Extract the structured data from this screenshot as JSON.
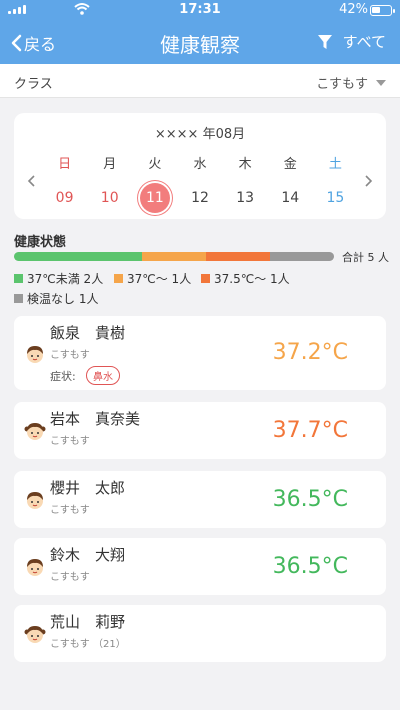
{
  "status_bar": {
    "time": "17:31",
    "battery": "42%"
  },
  "nav": {
    "back_label": "戻る",
    "title": "健康観察",
    "filter_label": "すべて"
  },
  "class_row": {
    "label": "クラス",
    "value": "こすもす"
  },
  "calendar": {
    "month": "×××× 年08月",
    "weekdays": [
      "日",
      "月",
      "火",
      "水",
      "木",
      "金",
      "土"
    ],
    "dates": [
      "09",
      "10",
      "11",
      "12",
      "13",
      "14",
      "15"
    ],
    "selected": "11"
  },
  "health": {
    "title": "健康状態",
    "total": "合計 5 人",
    "segments": [
      {
        "label": "37℃未満 2人",
        "count": 2,
        "color": "#5bc46d"
      },
      {
        "label": "37℃〜 1人",
        "count": 1,
        "color": "#f5a54a"
      },
      {
        "label": "37.5℃〜 1人",
        "count": 1,
        "color": "#f2763a"
      },
      {
        "label": "検温なし 1人",
        "count": 1,
        "color": "#999999"
      }
    ]
  },
  "students": [
    {
      "name": "飯泉　貴樹",
      "class": "こすもす",
      "symptom_label": "症状:",
      "symptom": "鼻水",
      "temp": "37.2°C",
      "temp_color": "#f5a54a",
      "avatar": "boy-avatar-icon"
    },
    {
      "name": "岩本　真奈美",
      "class": "こすもす",
      "temp": "37.7°C",
      "temp_color": "#f2763a",
      "avatar": "girl-avatar-icon"
    },
    {
      "name": "櫻井　太郎",
      "class": "こすもす",
      "temp": "36.5°C",
      "temp_color": "#43b85c",
      "avatar": "boy-avatar-icon"
    },
    {
      "name": "鈴木　大翔",
      "class": "こすもす",
      "temp": "36.5°C",
      "temp_color": "#43b85c",
      "avatar": "boy-avatar-icon"
    },
    {
      "name": "荒山　莉野",
      "class": "こすもす （21）",
      "temp": "",
      "temp_color": "#999999",
      "avatar": "girl-avatar-icon"
    }
  ]
}
